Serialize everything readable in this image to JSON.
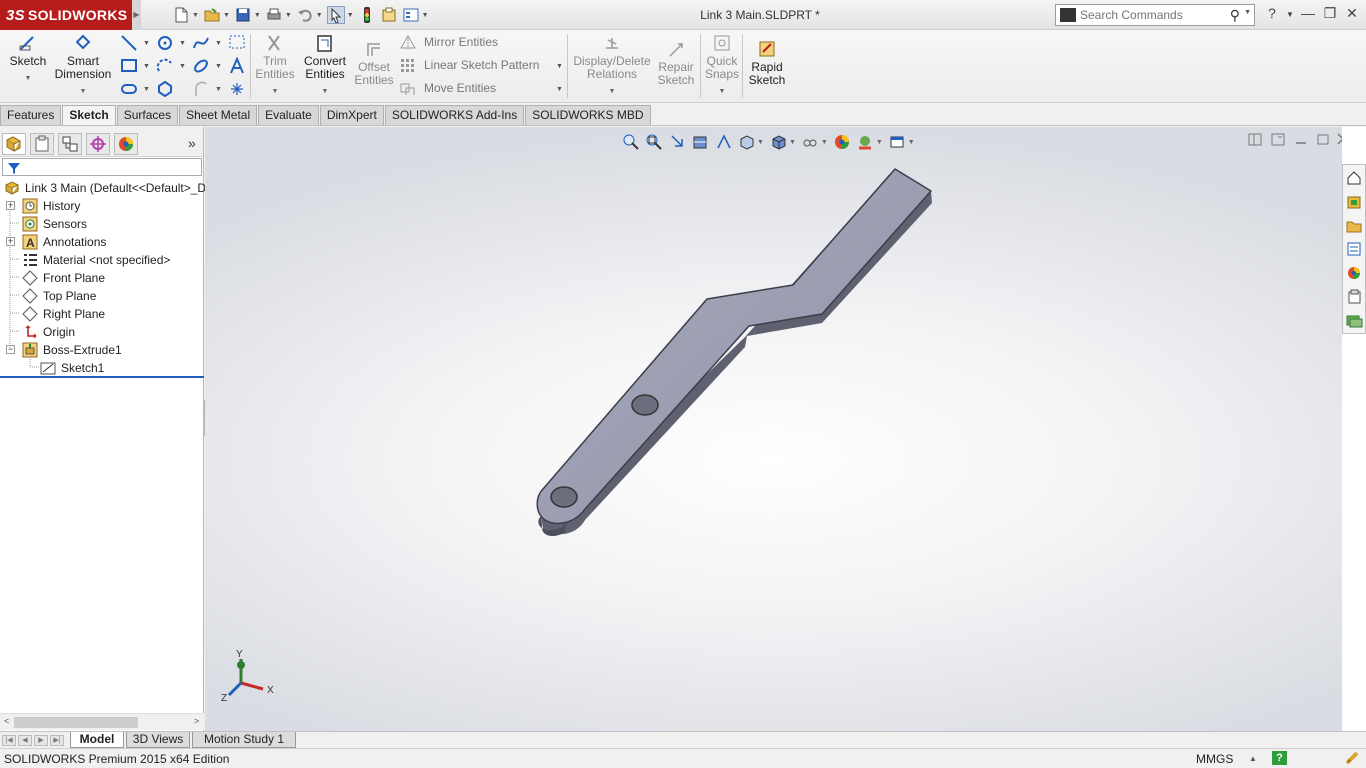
{
  "app": {
    "brand": "SOLIDWORKS",
    "brand_mark": "3S",
    "document_title": "Link 3 Main.SLDPRT *"
  },
  "search": {
    "placeholder": "Search Commands"
  },
  "command_manager": {
    "sketch": "Sketch",
    "smart_dimension": [
      "Smart",
      "Dimension"
    ],
    "trim_entities": [
      "Trim",
      "Entities"
    ],
    "convert_entities": [
      "Convert",
      "Entities"
    ],
    "offset_entities": [
      "Offset",
      "Entities"
    ],
    "mirror_entities": "Mirror Entities",
    "linear_sketch_pattern": "Linear Sketch Pattern",
    "move_entities": "Move Entities",
    "display_delete_relations": [
      "Display/Delete",
      "Relations"
    ],
    "repair_sketch": [
      "Repair",
      "Sketch"
    ],
    "quick_snaps": [
      "Quick",
      "Snaps"
    ],
    "rapid_sketch": [
      "Rapid",
      "Sketch"
    ]
  },
  "tabs": [
    "Features",
    "Sketch",
    "Surfaces",
    "Sheet Metal",
    "Evaluate",
    "DimXpert",
    "SOLIDWORKS Add-Ins",
    "SOLIDWORKS MBD"
  ],
  "active_tab": "Sketch",
  "tree": {
    "root": "Link 3 Main  (Default<<Default>_D",
    "items": [
      "History",
      "Sensors",
      "Annotations",
      "Material <not specified>",
      "Front Plane",
      "Top Plane",
      "Right Plane",
      "Origin",
      "Boss-Extrude1",
      "Sketch1"
    ]
  },
  "triad": {
    "x": "X",
    "y": "Y",
    "z": "Z"
  },
  "bottom_tabs": [
    "Model",
    "3D Views",
    "Motion Study 1"
  ],
  "status": {
    "edition": "SOLIDWORKS Premium 2015 x64 Edition",
    "units": "MMGS",
    "help": "?"
  },
  "colors": {
    "brand_red": "#b71c1c",
    "part_top": "#9ea0b4",
    "part_side": "#5f6170",
    "accent_blue": "#1f5fbf"
  }
}
